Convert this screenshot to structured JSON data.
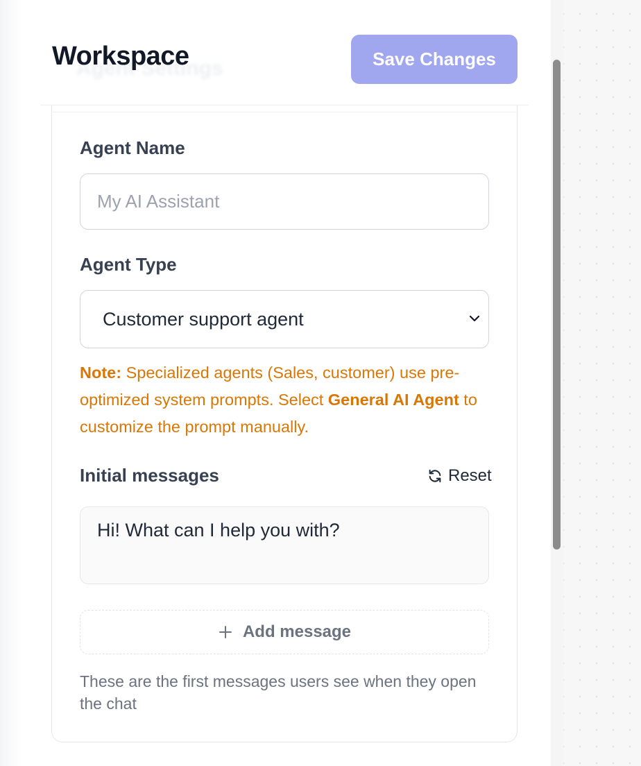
{
  "header": {
    "title": "Workspace",
    "save_label": "Save Changes"
  },
  "form": {
    "agent_name": {
      "label": "Agent Name",
      "placeholder": "My AI Assistant"
    },
    "agent_type": {
      "label": "Agent Type",
      "selected": "Customer support agent"
    },
    "note": {
      "prefix": "Note:",
      "text_before": " Specialized agents (Sales, customer) use pre-optimized system prompts. Select ",
      "emphasis": "General AI Agent",
      "text_after": " to customize the prompt manually."
    },
    "initial_messages": {
      "label": "Initial messages",
      "reset_label": "Reset",
      "messages": [
        "Hi! What can I help you with?"
      ],
      "add_label": "Add message",
      "help_text": "These are the first messages users see when they open the chat"
    }
  },
  "colors": {
    "accent": "#a1a7ee",
    "note": "#d97706",
    "title": "#111827"
  },
  "icons": {
    "select": "chevron-down-icon",
    "reset": "refresh-icon",
    "add": "plus-icon"
  }
}
